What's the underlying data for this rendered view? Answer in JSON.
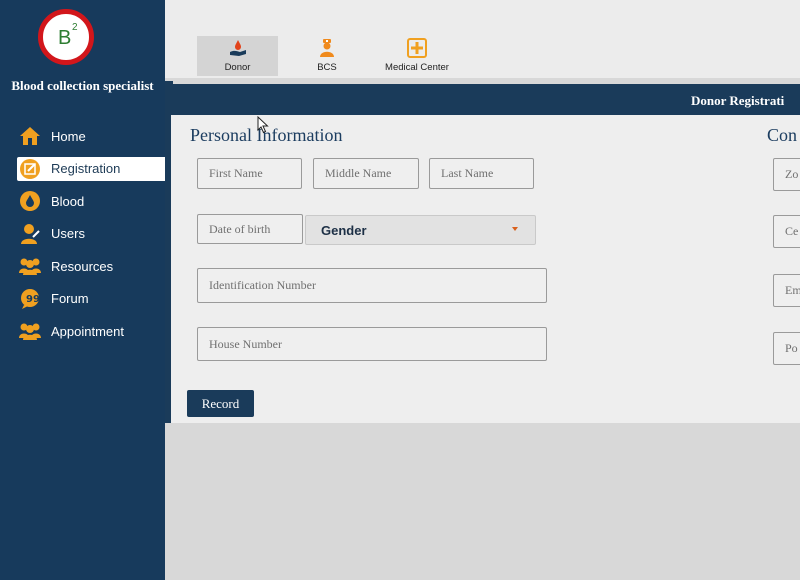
{
  "app": {
    "logo_letter": "B",
    "logo_superscript": "2",
    "name": "Blood collection specialist"
  },
  "sidebar": {
    "items": [
      {
        "label": "Home",
        "icon": "home-icon",
        "active": false
      },
      {
        "label": "Registration",
        "icon": "edit-icon",
        "active": true
      },
      {
        "label": "Blood",
        "icon": "blood-icon",
        "active": false
      },
      {
        "label": "Users",
        "icon": "user-icon",
        "active": false
      },
      {
        "label": "Resources",
        "icon": "people-icon",
        "active": false
      },
      {
        "label": "Forum",
        "icon": "chat-icon",
        "active": false
      },
      {
        "label": "Appointment",
        "icon": "group-icon",
        "active": false
      }
    ]
  },
  "tabs": [
    {
      "label": "Donor",
      "icon": "donor-icon",
      "active": true
    },
    {
      "label": "BCS",
      "icon": "nurse-icon",
      "active": false
    },
    {
      "label": "Medical Center",
      "icon": "medical-cross-icon",
      "active": false
    }
  ],
  "header": {
    "title": "Donor Registrati"
  },
  "personal": {
    "title": "Personal Information",
    "first_name": "First Name",
    "middle_name": "Middle Name",
    "last_name": "Last Name",
    "dob": "Date of birth",
    "gender": "Gender",
    "id_number": "Identification Number",
    "house_number": "House Number"
  },
  "contact": {
    "title": "Con",
    "fields": [
      "Zo",
      "Ce",
      "Em",
      "Po"
    ]
  },
  "record_button": "Record",
  "colors": {
    "sidebar": "#173a5c",
    "accent_orange": "#f0a020",
    "logo_red": "#d2161b"
  }
}
